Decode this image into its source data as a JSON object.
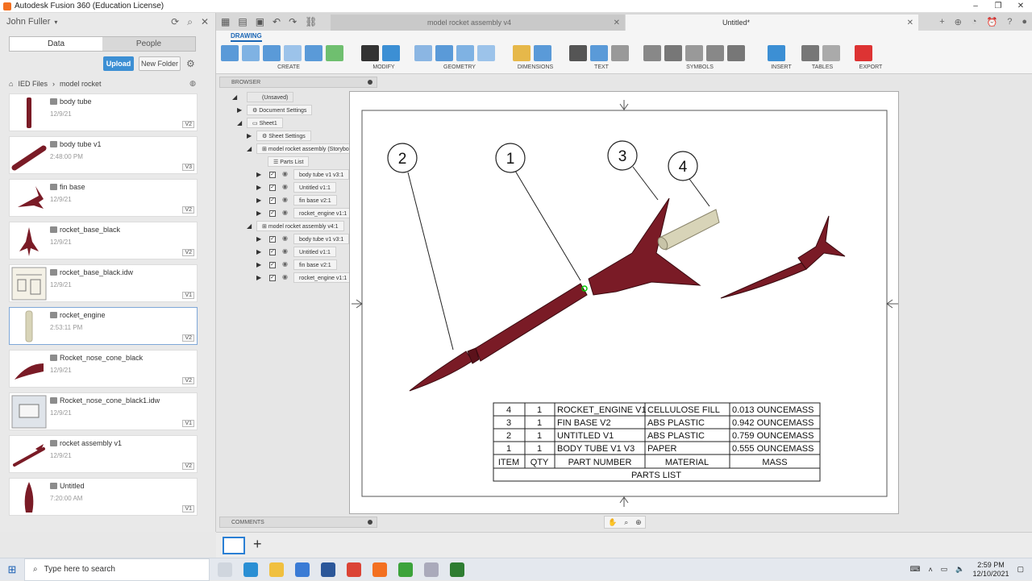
{
  "window": {
    "title": "Autodesk Fusion 360 (Education License)",
    "controls": [
      "–",
      "❐",
      "✕"
    ]
  },
  "data_panel": {
    "user": "John Fuller",
    "tabs": [
      "Data",
      "People"
    ],
    "upload_label": "Upload",
    "new_folder_label": "New Folder",
    "breadcrumb": [
      "IED Files",
      "model rocket"
    ],
    "files": [
      {
        "name": "body tube",
        "date": "12/9/21",
        "version": "V2",
        "thumb": "tube"
      },
      {
        "name": "body tube v1",
        "date": "2:48:00 PM",
        "version": "V3",
        "thumb": "tube-angled"
      },
      {
        "name": "fin base",
        "date": "12/9/21",
        "version": "V2",
        "thumb": "fins"
      },
      {
        "name": "rocket_base_black",
        "date": "12/9/21",
        "version": "V2",
        "thumb": "fins"
      },
      {
        "name": "rocket_base_black.idw",
        "date": "12/9/21",
        "version": "V1",
        "thumb": "drawing"
      },
      {
        "name": "rocket_engine",
        "date": "2:53:11 PM",
        "version": "V2",
        "thumb": "engine"
      },
      {
        "name": "Rocket_nose_cone_black",
        "date": "12/9/21",
        "version": "V2",
        "thumb": "cone"
      },
      {
        "name": "Rocket_nose_cone_black1.idw",
        "date": "12/9/21",
        "version": "V1",
        "thumb": "drawing"
      },
      {
        "name": "rocket assembly v1",
        "date": "12/9/21",
        "version": "V2",
        "thumb": "rocket"
      },
      {
        "name": "Untitled",
        "date": "7:20:00 AM",
        "version": "V1",
        "thumb": "cone-up"
      }
    ]
  },
  "tabs": [
    {
      "label": "model rocket assembly v4",
      "active": false
    },
    {
      "label": "Untitled*",
      "active": true
    }
  ],
  "ribbon": {
    "mode": "DRAWING",
    "groups": [
      "CREATE",
      "MODIFY",
      "GEOMETRY",
      "DIMENSIONS",
      "TEXT",
      "SYMBOLS",
      "INSERT",
      "TABLES",
      "EXPORT"
    ]
  },
  "browser": {
    "title": "BROWSER",
    "root": "(Unsaved)",
    "document_settings": "Document Settings",
    "sheet": "Sheet1",
    "sheet_settings": "Sheet Settings",
    "view1": "model rocket assembly (Storyboard ...",
    "parts_list": "Parts List",
    "view1_items": [
      "body tube v1 v3:1",
      "Untitled v1:1",
      "fin base v2:1",
      "rocket_engine v1:1"
    ],
    "view2": "model rocket assembly v4:1",
    "view2_items": [
      "body tube v1 v3:1",
      "Untitled v1:1",
      "fin base v2:1",
      "rocket_engine v1:1"
    ]
  },
  "comments_title": "COMMENTS",
  "drawing": {
    "balloons": [
      "2",
      "1",
      "3",
      "4"
    ],
    "parts_list": {
      "title": "PARTS LIST",
      "headers": [
        "ITEM",
        "QTY",
        "PART NUMBER",
        "MATERIAL",
        "MASS"
      ],
      "rows": [
        [
          "4",
          "1",
          "ROCKET_ENGINE V1",
          "CELLULOSE FILL",
          "0.013 OUNCEMASS"
        ],
        [
          "3",
          "1",
          "FIN BASE V2",
          "ABS PLASTIC",
          "0.942 OUNCEMASS"
        ],
        [
          "2",
          "1",
          "UNTITLED V1",
          "ABS PLASTIC",
          "0.759 OUNCEMASS"
        ],
        [
          "1",
          "1",
          "BODY TUBE V1 V3",
          "PAPER",
          "0.555 OUNCEMASS"
        ]
      ]
    }
  },
  "taskbar": {
    "search_placeholder": "Type here to search",
    "time": "2:59 PM",
    "date": "12/10/2021"
  },
  "colors": {
    "rocket": "#7a1b26",
    "engine": "#d8d4b8",
    "accent": "#2a7fd4",
    "upload": "#3c8fd4"
  }
}
